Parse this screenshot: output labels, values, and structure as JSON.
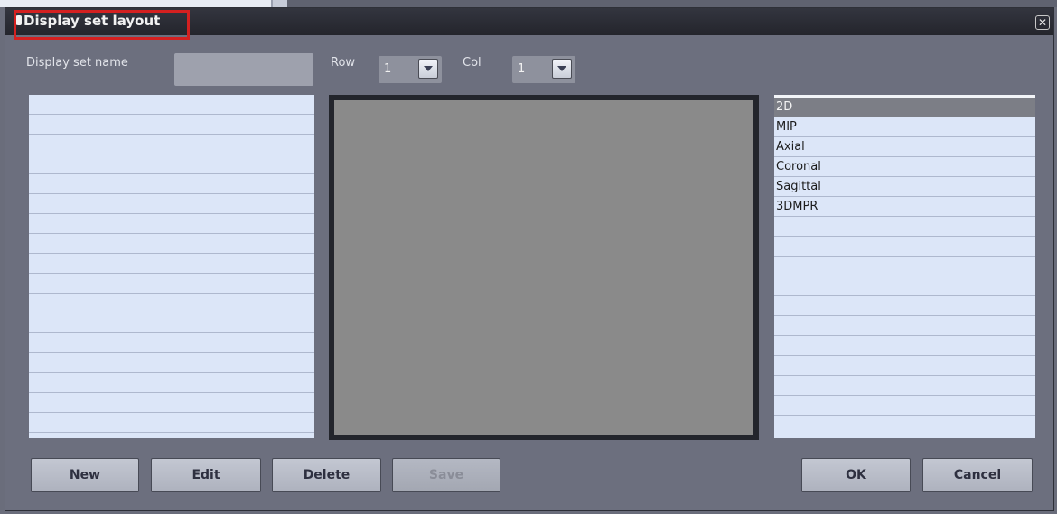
{
  "dialog": {
    "title": "Display set layout",
    "close_glyph": "✕"
  },
  "form": {
    "name_label": "Display set name",
    "name_value": "",
    "row_label": "Row",
    "row_value": "1",
    "col_label": "Col",
    "col_value": "1"
  },
  "view_types": {
    "items": [
      "2D",
      "MIP",
      "Axial",
      "Coronal",
      "Sagittal",
      "3DMPR"
    ],
    "selected": "2D"
  },
  "buttons": {
    "new": "New",
    "edit": "Edit",
    "delete": "Delete",
    "save": "Save",
    "ok": "OK",
    "cancel": "Cancel"
  },
  "colors": {
    "title_highlight": "#d42020",
    "dialog_bg": "#6c6f7e",
    "list_bg": "#dce6f8",
    "preview_bg": "#8a8a8a"
  }
}
